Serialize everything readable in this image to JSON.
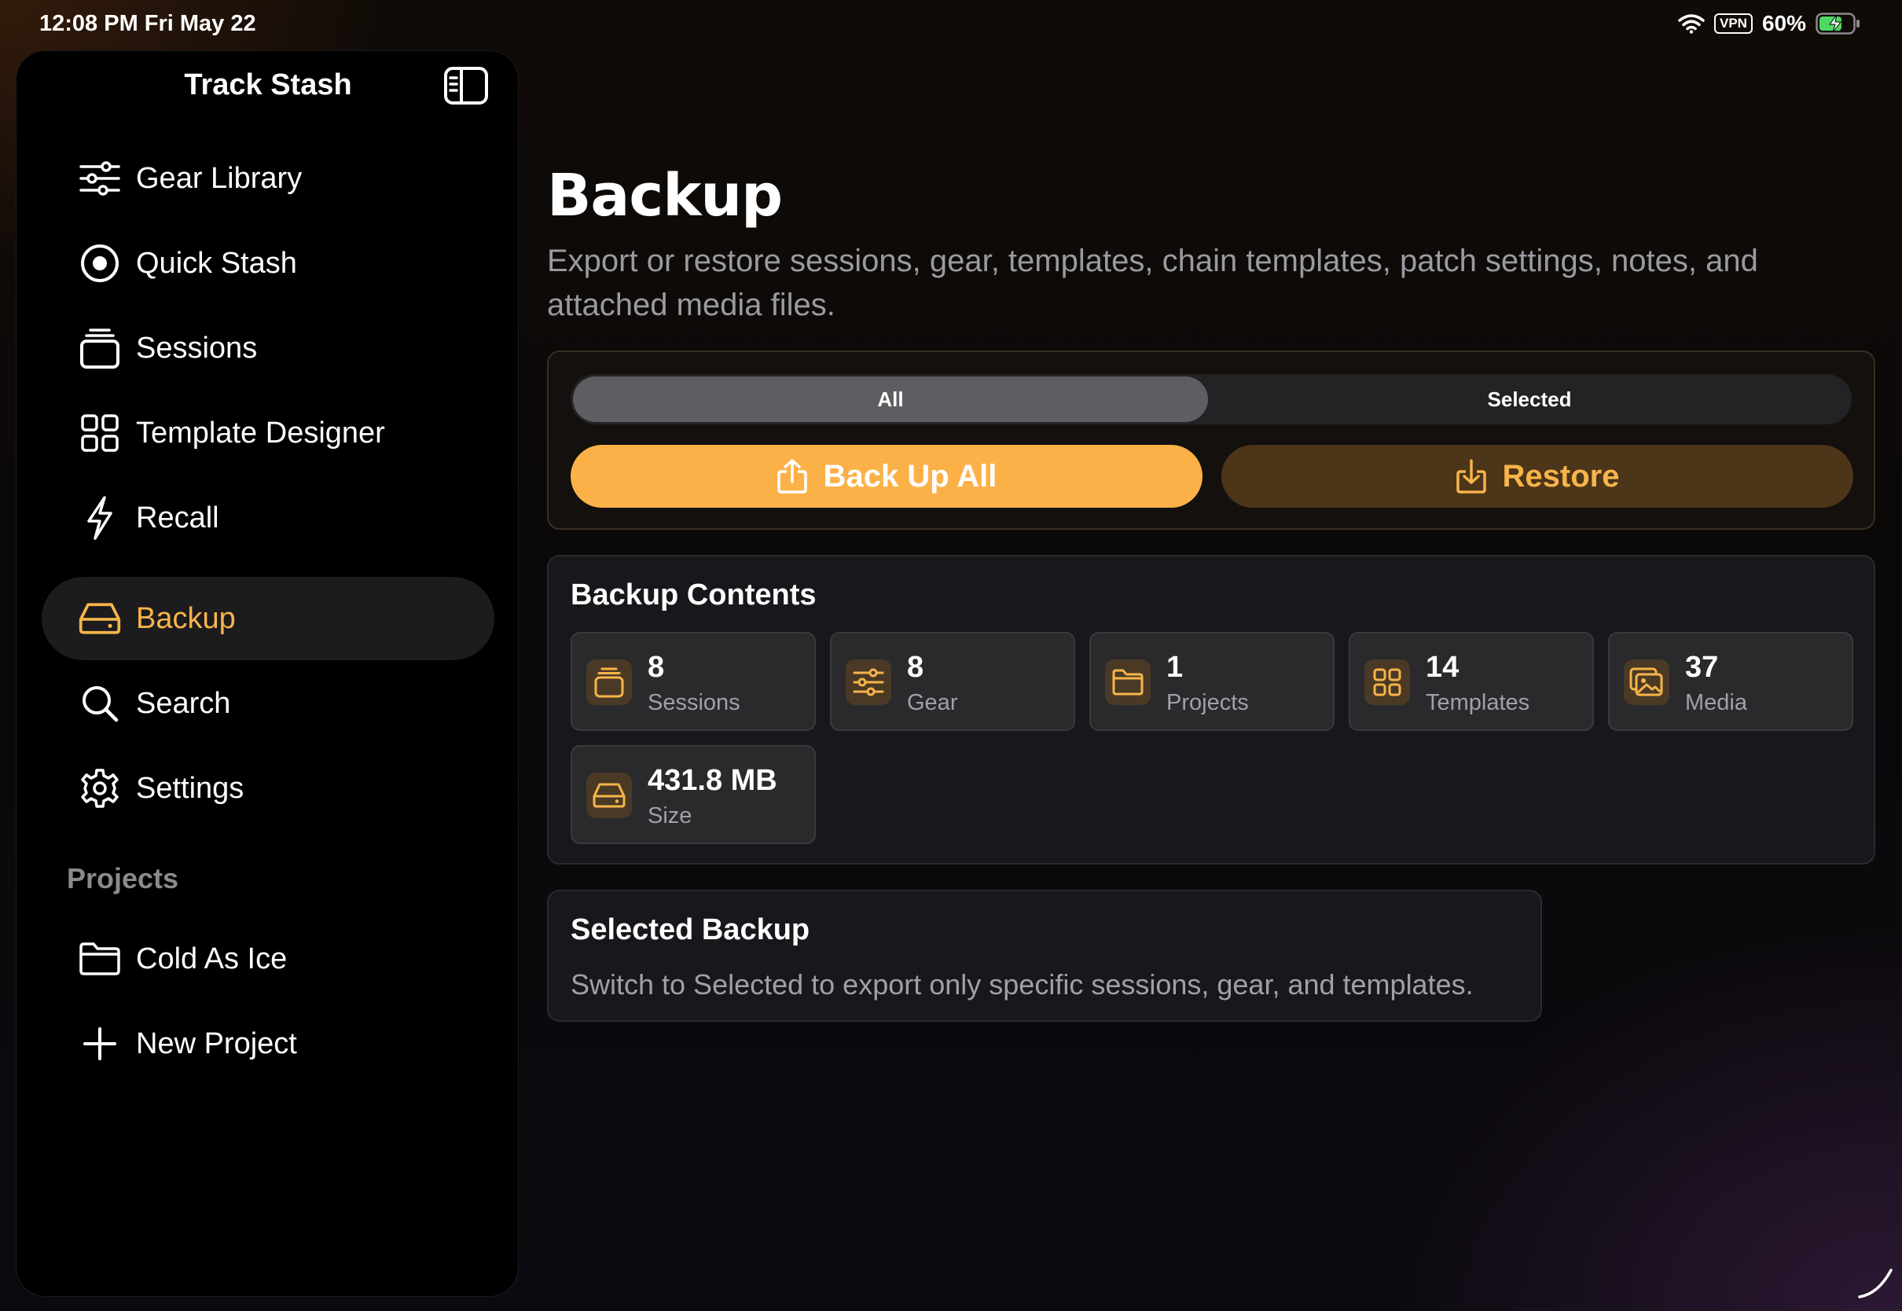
{
  "status_bar": {
    "time": "12:08 PM   Fri May 22",
    "vpn": "VPN",
    "battery": "60%"
  },
  "sidebar": {
    "title": "Track Stash",
    "items": [
      {
        "label": "Gear Library",
        "icon": "sliders-icon"
      },
      {
        "label": "Quick Stash",
        "icon": "record-circle-icon"
      },
      {
        "label": "Sessions",
        "icon": "stack-icon"
      },
      {
        "label": "Template Designer",
        "icon": "grid-icon"
      },
      {
        "label": "Recall",
        "icon": "bolt-icon"
      },
      {
        "label": "Backup",
        "icon": "drive-icon",
        "active": true
      },
      {
        "label": "Search",
        "icon": "search-icon"
      },
      {
        "label": "Settings",
        "icon": "gear-icon"
      }
    ],
    "projects_header": "Projects",
    "projects": [
      {
        "label": "Cold As Ice",
        "icon": "folder-icon"
      },
      {
        "label": "New Project",
        "icon": "plus-icon"
      }
    ]
  },
  "main": {
    "title": "Backup",
    "subtitle": "Export or restore sessions, gear, templates, chain templates, patch settings, notes, and attached media files.",
    "segments": {
      "all": "All",
      "selected": "Selected",
      "active": "all"
    },
    "buttons": {
      "backup": "Back Up All",
      "restore": "Restore"
    },
    "contents": {
      "heading": "Backup Contents",
      "stats": [
        {
          "value": "8",
          "label": "Sessions",
          "icon": "stack-icon"
        },
        {
          "value": "8",
          "label": "Gear",
          "icon": "sliders-icon"
        },
        {
          "value": "1",
          "label": "Projects",
          "icon": "folder-icon"
        },
        {
          "value": "14",
          "label": "Templates",
          "icon": "grid-icon"
        },
        {
          "value": "37",
          "label": "Media",
          "icon": "photos-icon"
        },
        {
          "value": "431.8 MB",
          "label": "Size",
          "icon": "drive-icon"
        }
      ]
    },
    "selected_backup": {
      "heading": "Selected Backup",
      "description": "Switch to Selected to export only specific sessions, gear, and templates."
    }
  },
  "colors": {
    "accent": "#f7b44a",
    "accent_button": "#fbb148",
    "restore_button": "#4c3518",
    "sidebar_bg": "#000000"
  }
}
